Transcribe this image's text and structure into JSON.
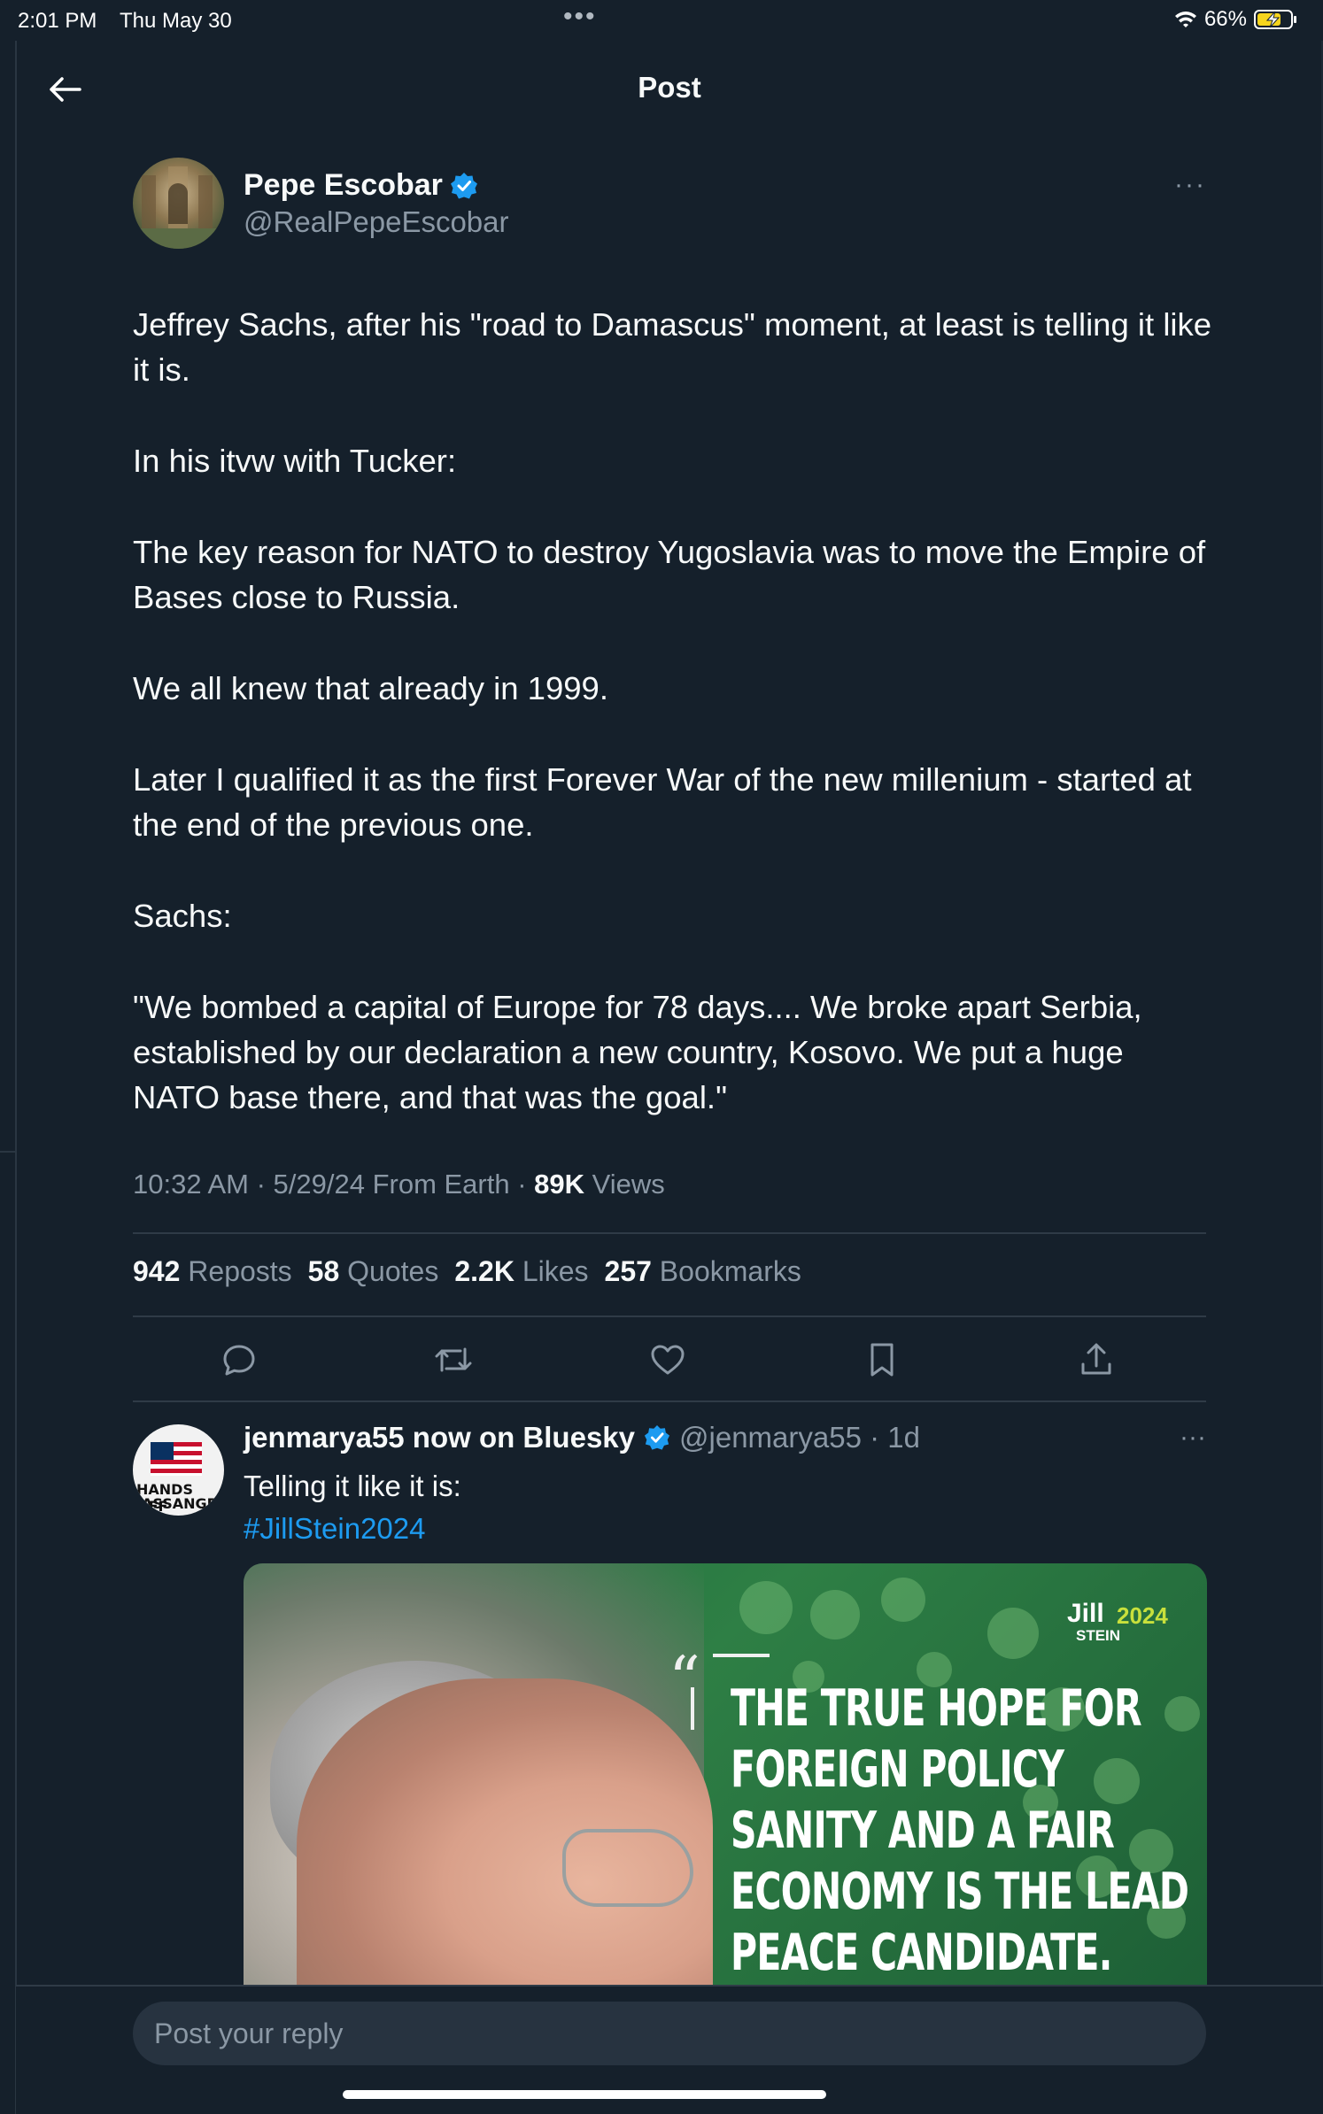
{
  "status_bar": {
    "time": "2:01 PM",
    "date": "Thu May 30",
    "battery": "66%",
    "multitask_icon": "ellipsis-icon"
  },
  "header": {
    "title": "Post",
    "back_icon": "arrow-left-icon"
  },
  "post": {
    "author_name": "Pepe Escobar",
    "author_handle": "@RealPepeEscobar",
    "more": "···",
    "paragraphs": [
      "Jeffrey Sachs, after his \"road to Damascus\" moment, at least is telling it like it is.",
      "In his itvw with Tucker:",
      "The key reason for NATO to destroy Yugoslavia was to move the Empire of Bases close to Russia.",
      "We all knew that already in 1999.",
      "Later I qualified it as the first Forever War of the new millenium - started at the end of the previous one.",
      "Sachs:",
      "\"We bombed a capital of Europe for 78 days.... We broke apart Serbia, established by our declaration a new country, Kosovo. We put a huge NATO base there, and that was the goal.\""
    ],
    "timestamp": "10:32 AM · 5/29/24 From Earth · ",
    "views_count": "89K",
    "views_label": " Views",
    "stats": {
      "reposts_count": "942",
      "reposts_label": "Reposts",
      "quotes_count": "58",
      "quotes_label": "Quotes",
      "likes_count": "2.2K",
      "likes_label": "Likes",
      "bookmarks_count": "257",
      "bookmarks_label": "Bookmarks"
    },
    "actions": [
      "reply-icon",
      "repost-icon",
      "like-icon",
      "bookmark-icon",
      "share-icon"
    ]
  },
  "reply": {
    "author_name": "jenmarya55 now on Bluesky",
    "author_handle": "@jenmarya55 · 1d",
    "more": "···",
    "text": "Telling it like it is:",
    "hashtag": "#JillStein2024",
    "avatar_text_1": "HANDS OFF",
    "avatar_text_2": "ASSANGE",
    "media": {
      "logo_name": "Jill",
      "logo_year": "2024",
      "logo_surname": "STEIN",
      "quote_lines": [
        "THE TRUE HOPE FOR",
        "FOREIGN POLICY",
        "SANITY AND A FAIR",
        "ECONOMY IS THE LEAD",
        "PEACE CANDIDATE."
      ],
      "quote_mark": "“"
    }
  },
  "composer": {
    "placeholder": "Post your reply"
  },
  "colors": {
    "background": "#15202b",
    "accent": "#1d9bf0",
    "muted": "#8b98a5"
  }
}
